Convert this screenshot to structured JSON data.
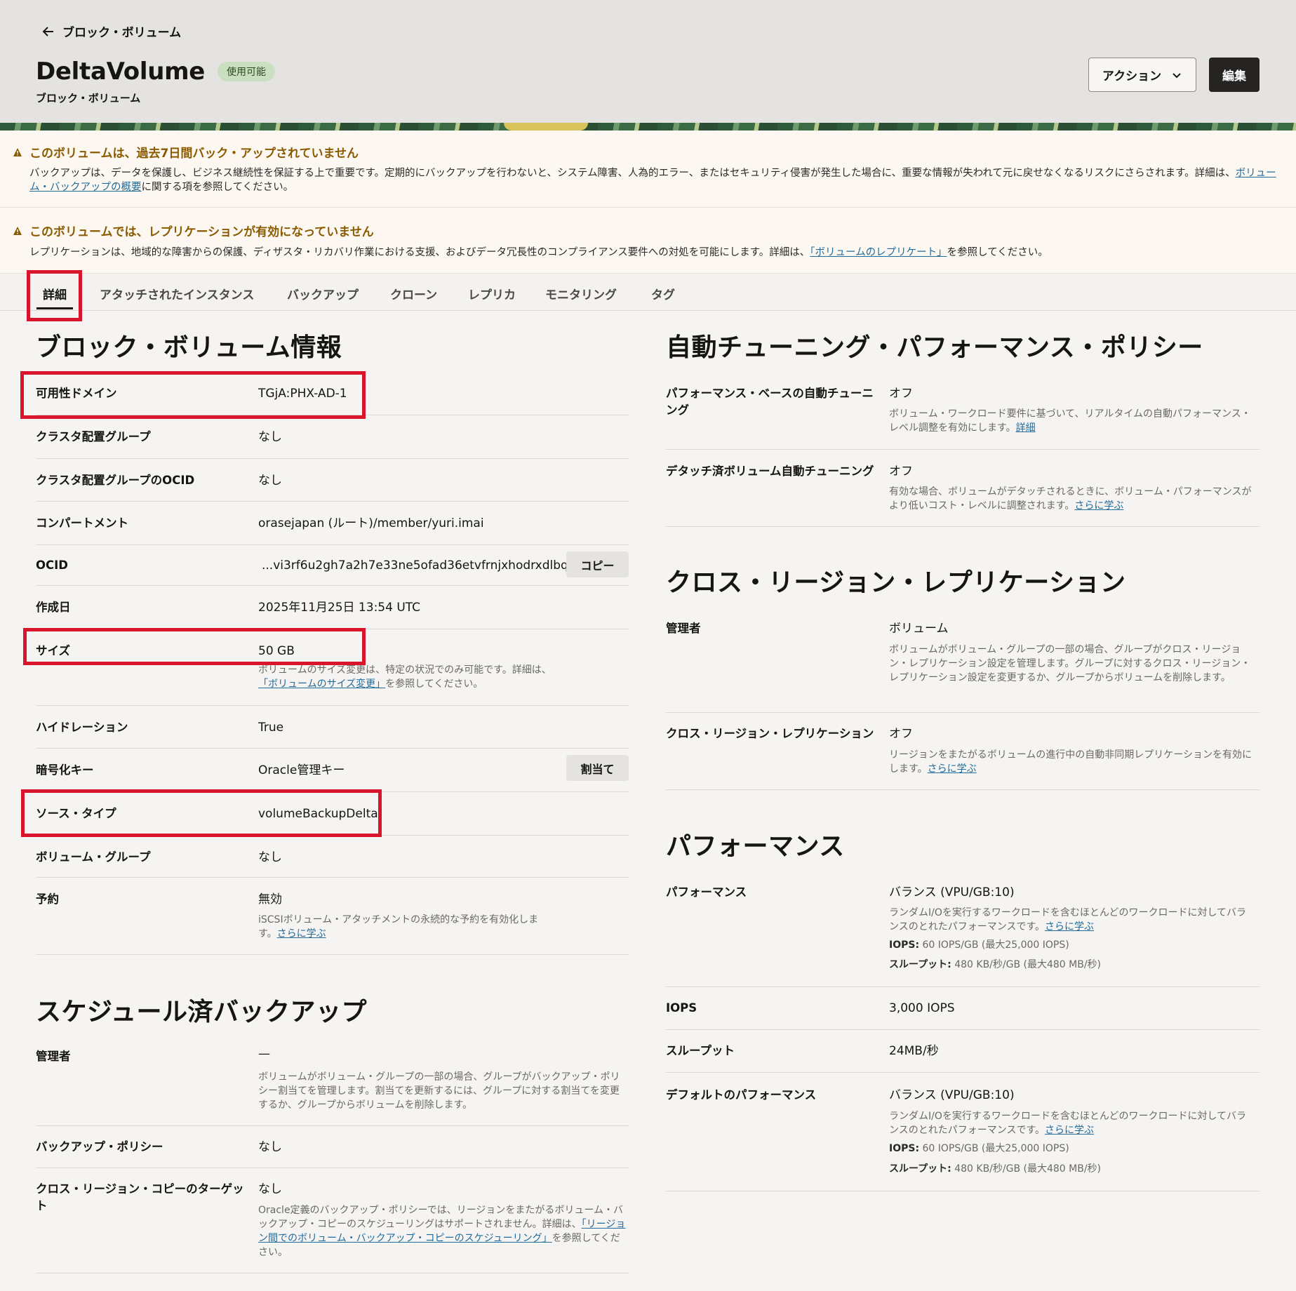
{
  "header": {
    "back_label": "ブロック・ボリューム",
    "title": "DeltaVolume",
    "status": "使用可能",
    "subtitle": "ブロック・ボリューム",
    "action_label": "アクション",
    "edit_label": "編集"
  },
  "warnings": [
    {
      "title": "このボリュームは、過去7日間バック・アップされていません",
      "body_before": "バックアップは、データを保護し、ビジネス継続性を保証する上で重要です。定期的にバックアップを行わないと、システム障害、人為的エラー、またはセキュリティ侵害が発生した場合に、重要な情報が失われて元に戻せなくなるリスクにさらされます。詳細は、",
      "link": "ボリューム・バックアップの概要",
      "body_after": "に関する項を参照してください。"
    },
    {
      "title": "このボリュームでは、レプリケーションが有効になっていません",
      "body_before": "レプリケーションは、地域的な障害からの保護、ディザスタ・リカバリ作業における支援、およびデータ冗長性のコンプライアンス要件への対処を可能にします。詳細は、",
      "link": "「ボリュームのレプリケート」",
      "body_after": "を参照してください。"
    }
  ],
  "tabs": [
    "詳細",
    "アタッチされたインスタンス",
    "バックアップ",
    "クローン",
    "レプリカ",
    "モニタリング",
    "タグ"
  ],
  "info": {
    "heading": "ブロック・ボリューム情報",
    "availability_domain": {
      "label": "可用性ドメイン",
      "value": "TGjA:PHX-AD-1"
    },
    "cluster_group": {
      "label": "クラスタ配置グループ",
      "value": "なし"
    },
    "cluster_group_ocid": {
      "label": "クラスタ配置グループのOCID",
      "value": "なし"
    },
    "compartment": {
      "label": "コンパートメント",
      "value": "orasejapan (ルート)/member/yuri.imai"
    },
    "ocid": {
      "label": "OCID",
      "value": "...vi3rf6u2gh7a2h7e33ne5ofad36etvfrnjxhodrxdlbq",
      "button": "コピー"
    },
    "created": {
      "label": "作成日",
      "value": "2025年11月25日 13:54 UTC"
    },
    "size": {
      "label": "サイズ",
      "value": "50 GB",
      "desc_before": "ボリュームのサイズ変更は、特定の状況でのみ可能です。詳細は、",
      "desc_link": "「ボリュームのサイズ変更」",
      "desc_after": "を参照してください。"
    },
    "hydration": {
      "label": "ハイドレーション",
      "value": "True"
    },
    "encryption": {
      "label": "暗号化キー",
      "value": "Oracle管理キー",
      "button": "割当て"
    },
    "source_type": {
      "label": "ソース・タイプ",
      "value": "volumeBackupDelta"
    },
    "volume_group": {
      "label": "ボリューム・グループ",
      "value": "なし"
    },
    "reservation": {
      "label": "予約",
      "value": "無効",
      "desc": "iSCSIボリューム・アタッチメントの永続的な予約を有効化します。",
      "desc_link": "さらに学ぶ"
    }
  },
  "scheduled": {
    "heading": "スケジュール済バックアップ",
    "admin": {
      "label": "管理者",
      "value": "—",
      "desc": "ボリュームがボリューム・グループの一部の場合、グループがバックアップ・ポリシー割当てを管理します。割当てを更新するには、グループに対する割当てを変更するか、グループからボリュームを削除します。"
    },
    "policy": {
      "label": "バックアップ・ポリシー",
      "value": "なし"
    },
    "cross_region": {
      "label": "クロス・リージョン・コピーのターゲット",
      "value": "なし",
      "desc_before": "Oracle定義のバックアップ・ポリシーでは、リージョンをまたがるボリューム・バックアップ・コピーのスケジューリングはサポートされません。詳細は、",
      "desc_link": "「リージョン間でのボリューム・バックアップ・コピーのスケジューリング」",
      "desc_after": "を参照してください。"
    }
  },
  "tuning": {
    "heading": "自動チューニング・パフォーマンス・ポリシー",
    "perf_based": {
      "label": "パフォーマンス・ベースの自動チューニング",
      "value": "オフ",
      "desc": "ボリューム・ワークロード要件に基づいて、リアルタイムの自動パフォーマンス・レベル調整を有効にします。",
      "desc_link": "詳細"
    },
    "detached": {
      "label": "デタッチ済ボリューム自動チューニング",
      "value": "オフ",
      "desc": "有効な場合、ボリュームがデタッチされるときに、ボリューム・パフォーマンスがより低いコスト・レベルに調整されます。",
      "desc_link": "さらに学ぶ"
    }
  },
  "replication": {
    "heading": "クロス・リージョン・レプリケーション",
    "admin": {
      "label": "管理者",
      "value": "ボリューム",
      "desc": "ボリュームがボリューム・グループの一部の場合、グループがクロス・リージョン・レプリケーション設定を管理します。グループに対するクロス・リージョン・レプリケーション設定を変更するか、グループからボリュームを削除します。"
    },
    "crr": {
      "label": "クロス・リージョン・レプリケーション",
      "value": "オフ",
      "desc": "リージョンをまたがるボリュームの進行中の自動非同期レプリケーションを有効にします。",
      "desc_link": "さらに学ぶ"
    }
  },
  "performance": {
    "heading": "パフォーマンス",
    "perf": {
      "label": "パフォーマンス",
      "value": "バランス (VPU/GB:10)",
      "desc": "ランダムI/Oを実行するワークロードを含むほとんどのワークロードに対してバランスのとれたパフォーマンスです。",
      "desc_link": "さらに学ぶ",
      "iops_label": "IOPS:",
      "iops_value": "60 IOPS/GB (最大25,000 IOPS)",
      "tp_label": "スループット:",
      "tp_value": "480 KB/秒/GB (最大480 MB/秒)"
    },
    "iops": {
      "label": "IOPS",
      "value": "3,000 IOPS"
    },
    "throughput": {
      "label": "スループット",
      "value": "24MB/秒"
    },
    "default": {
      "label": "デフォルトのパフォーマンス",
      "value": "バランス (VPU/GB:10)",
      "desc": "ランダムI/Oを実行するワークロードを含むほとんどのワークロードに対してバランスのとれたパフォーマンスです。",
      "desc_link": "さらに学ぶ",
      "iops_label": "IOPS:",
      "iops_value": "60 IOPS/GB (最大25,000 IOPS)",
      "tp_label": "スループット:",
      "tp_value": "480 KB/秒/GB (最大480 MB/秒)"
    }
  },
  "colors": {
    "highlight": "#d8152a",
    "warning": "#8a5a00",
    "link": "#236b9a",
    "status_badge": "#c9dfbf"
  }
}
